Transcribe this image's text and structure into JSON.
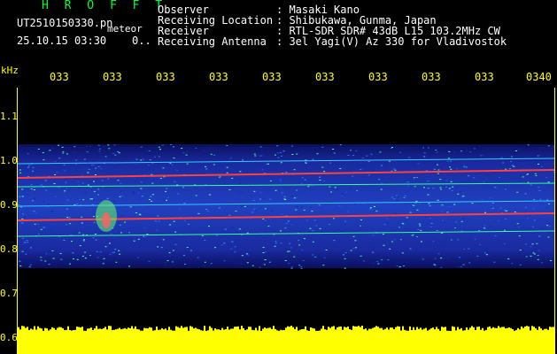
{
  "title": "H R O F F T",
  "file_label": "UT2510150330.pn",
  "meteor_label": "meteor",
  "datetime_label": "25.10.15 03:30    0..",
  "info": {
    "observer_key": "Observer",
    "observer_val": ": Masaki Kano",
    "location_key": "Receiving Location",
    "location_val": ": Shibukawa, Gunma, Japan",
    "receiver_key": "Receiver",
    "receiver_val": ": RTL-SDR SDR# 43dB L15 103.2MHz CW",
    "antenna_key": "Receiving Antenna",
    "antenna_val": ": 3el Yagi(V) Az 330 for Vladivostok"
  },
  "y_axis_unit": "kHz",
  "x_ticks": [
    "033",
    "033",
    "033",
    "033",
    "033",
    "033",
    "033",
    "033",
    "033",
    "0340"
  ],
  "y_ticks": [
    "1.1",
    "1.0",
    "0.9",
    "0.8",
    "0.7",
    "0.6"
  ],
  "colors": {
    "axis": "#ffff00",
    "header": "#00ff33",
    "text": "#ffffff",
    "band": "#1a2a9a",
    "line": "#ff3333"
  }
}
